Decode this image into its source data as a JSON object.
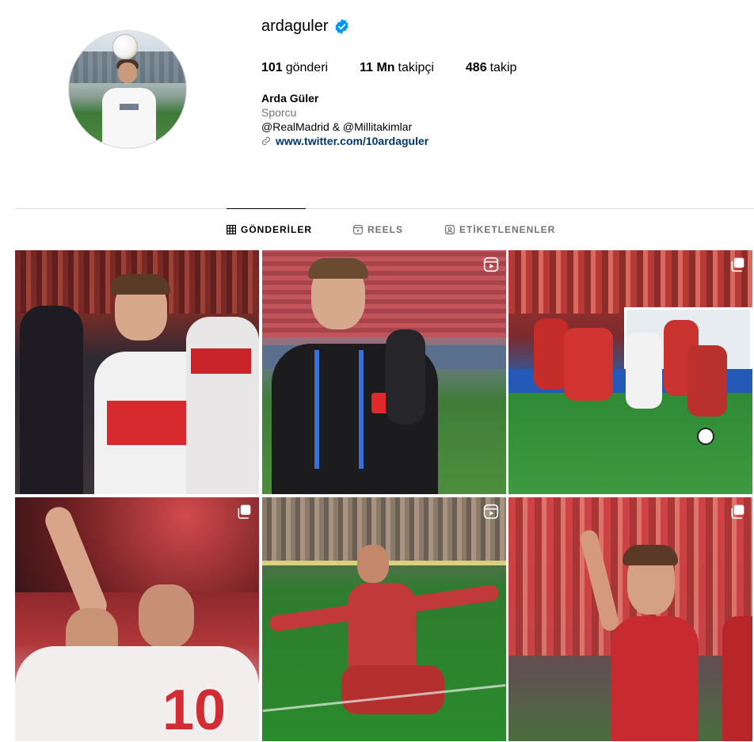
{
  "profile": {
    "username": "ardaguler",
    "verified": true,
    "stats": {
      "posts_count": "101",
      "posts_label": "gönderi",
      "followers_count": "11 Mn",
      "followers_label": "takipçi",
      "following_count": "486",
      "following_label": "takip"
    },
    "bio": {
      "name": "Arda Güler",
      "category": "Sporcu",
      "text": "@RealMadrid & @Millitakimlar",
      "link": "www.twitter.com/10ardaguler"
    }
  },
  "tabs": [
    {
      "label": "GÖNDERİLER",
      "icon": "grid-icon",
      "active": true
    },
    {
      "label": "REELS",
      "icon": "reels-icon",
      "active": false
    },
    {
      "label": "ETİKETLENENLER",
      "icon": "tagged-icon",
      "active": false
    }
  ],
  "posts": [
    {
      "type": "image"
    },
    {
      "type": "reel",
      "badge": "reel-icon"
    },
    {
      "type": "carousel",
      "badge": "carousel-icon"
    },
    {
      "type": "carousel",
      "badge": "carousel-icon"
    },
    {
      "type": "reel",
      "badge": "reel-icon"
    },
    {
      "type": "carousel",
      "badge": "carousel-icon"
    }
  ],
  "colors": {
    "verified_blue": "#0095f6",
    "link_blue": "#00376b",
    "muted_gray": "#737373",
    "divider": "#dbdbdb"
  }
}
